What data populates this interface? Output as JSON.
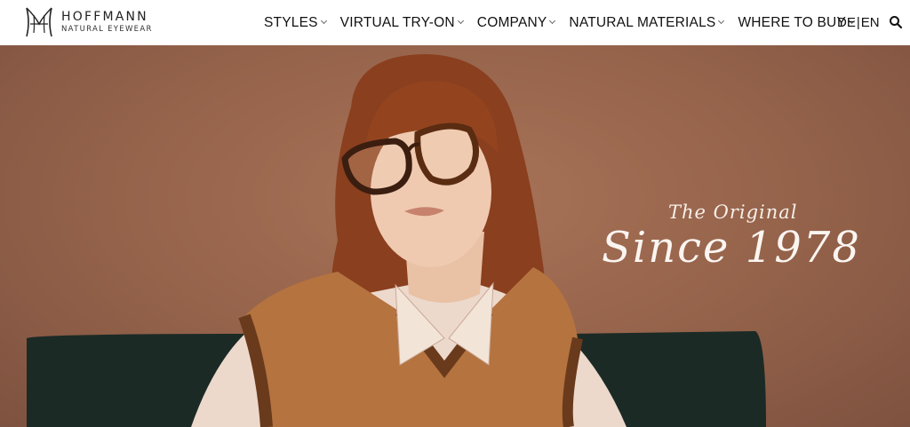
{
  "header": {
    "brand_name": "HOFFMANN",
    "brand_sub": "NATURAL EYEWEAR",
    "nav": [
      {
        "label": "STYLES"
      },
      {
        "label": "VIRTUAL TRY-ON"
      },
      {
        "label": "COMPANY"
      },
      {
        "label": "NATURAL MATERIALS"
      },
      {
        "label": "WHERE TO BUY"
      }
    ],
    "lang_de": "DE",
    "lang_sep": "|",
    "lang_en": "EN",
    "search_icon": "search-icon"
  },
  "hero": {
    "tagline": "The Original",
    "headline": "Since 1978"
  },
  "colors": {
    "background": "#9a6a52",
    "hero_text": "#fbf5f1"
  }
}
